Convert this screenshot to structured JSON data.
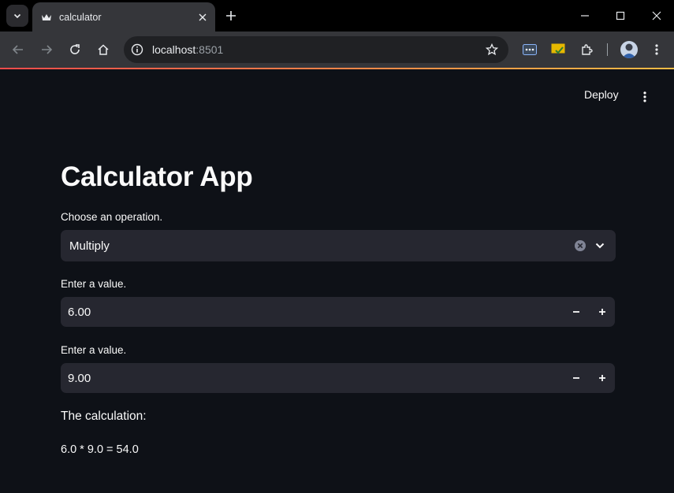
{
  "browser": {
    "tab_title": "calculator",
    "url_host": "localhost",
    "url_port": ":8501"
  },
  "app": {
    "deploy_label": "Deploy",
    "title": "Calculator App",
    "operation": {
      "label": "Choose an operation.",
      "selected": "Multiply"
    },
    "value1": {
      "label": "Enter a value.",
      "value": "6.00"
    },
    "value2": {
      "label": "Enter a value.",
      "value": "9.00"
    },
    "calc_heading": "The calculation:",
    "calc_result": "6.0 * 9.0 = 54.0",
    "colors": {
      "background": "#0e1117",
      "input_bg": "#262730",
      "text": "#fafafa",
      "accent_start": "#ff4b4b",
      "accent_end": "#ffbd45"
    }
  }
}
